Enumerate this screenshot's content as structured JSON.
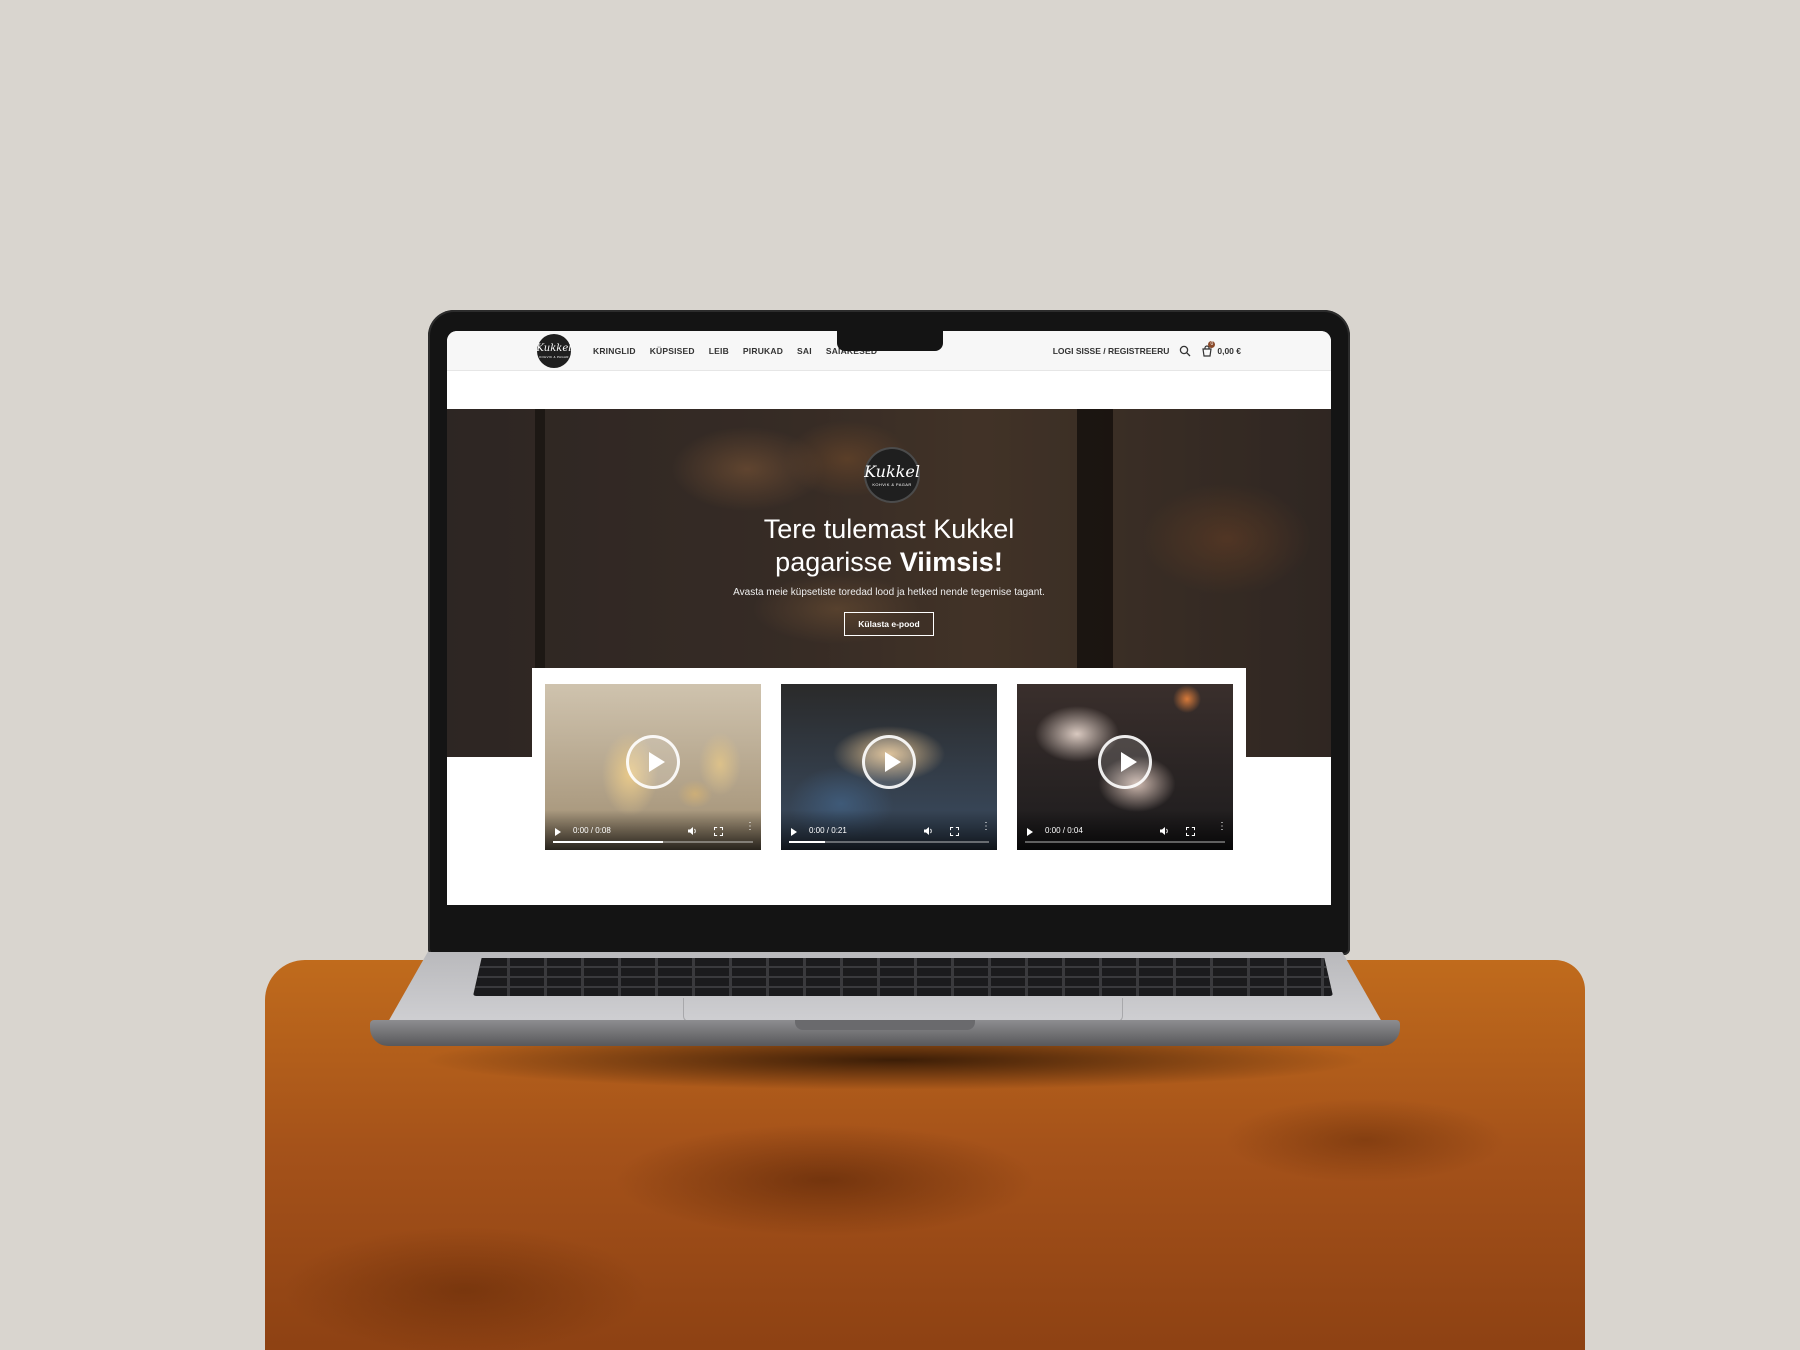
{
  "site": {
    "logo": {
      "word": "Kukkel",
      "tagline": "KOHVIK & PAGAR"
    },
    "nav": [
      "KRINGLID",
      "KÜPSISED",
      "LEIB",
      "PIRUKAD",
      "SAI",
      "SAIAKESED"
    ],
    "header_right": {
      "login_label": "LOGI SISSE / REGISTREERU",
      "search_icon": "search-icon",
      "cart_icon": "cart-icon",
      "cart_count": "0",
      "cart_total": "0,00 €"
    }
  },
  "hero": {
    "title_line1": "Tere tulemast Kukkel",
    "title_line2_start": "pagarisse ",
    "title_line2_bold": "Viimsis!",
    "subtitle": "Avasta meie küpsetiste toredad lood ja hetked nende tegemise tagant.",
    "cta_label": "Külasta e-pood"
  },
  "videos": [
    {
      "time": "0:00 / 0:08",
      "progress": 0.55
    },
    {
      "time": "0:00 / 0:21",
      "progress": 0.18
    },
    {
      "time": "0:00 / 0:04",
      "progress": 0.0
    }
  ],
  "colors": {
    "background": "#d9d5cf",
    "pedestal": "#b0581a",
    "header_bg": "#f7f7f7",
    "accent": "#8a4a2a"
  }
}
